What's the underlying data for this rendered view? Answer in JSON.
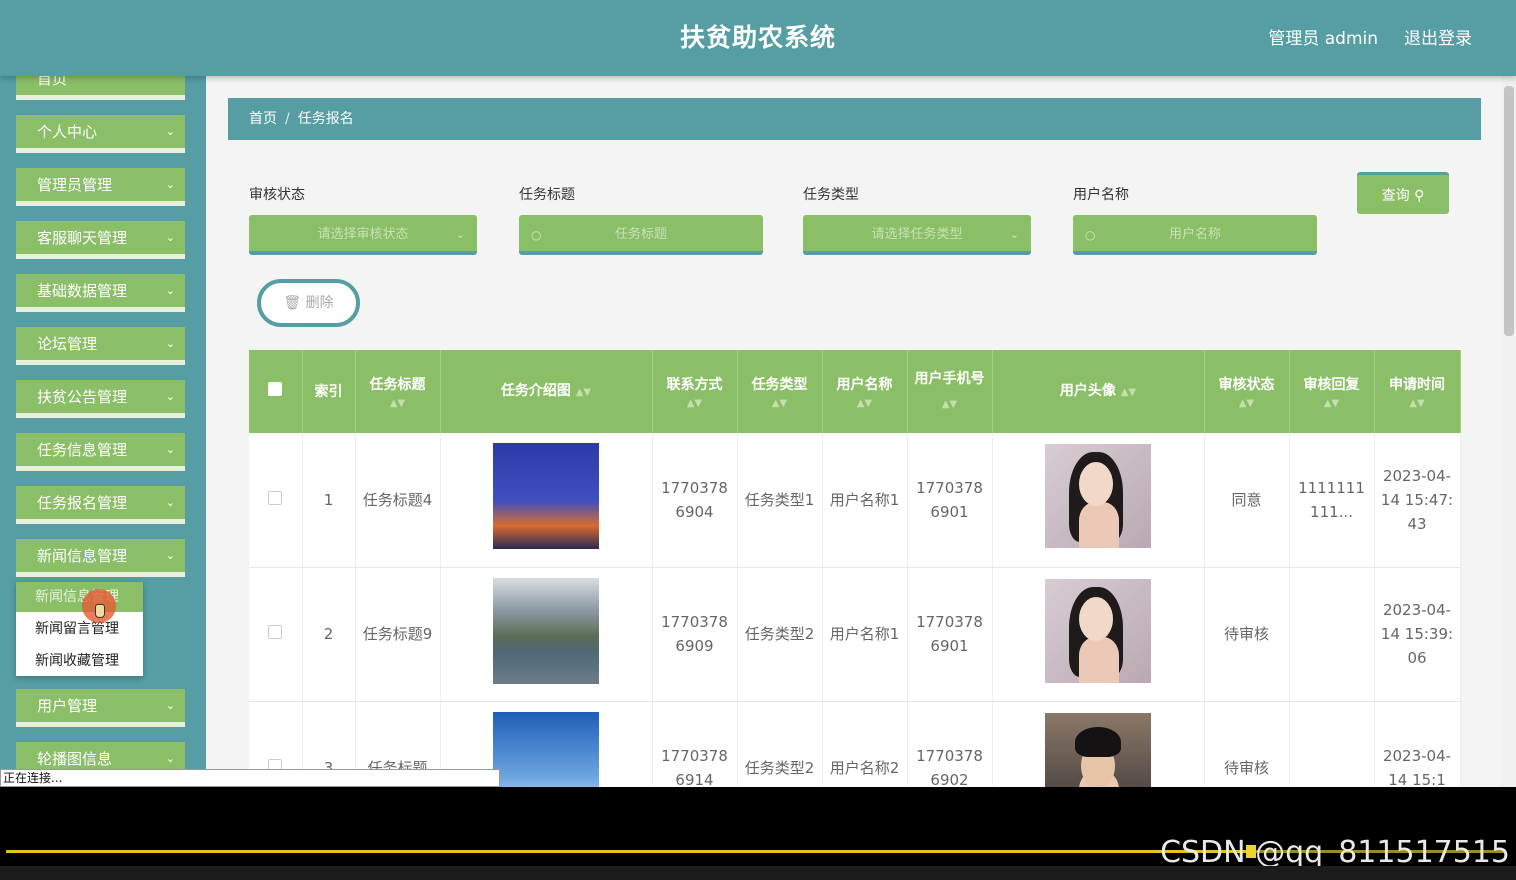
{
  "header": {
    "title": "扶贫助农系统",
    "user": "管理员 admin",
    "logout": "退出登录"
  },
  "sidebar": {
    "items": [
      {
        "label": "首页"
      },
      {
        "label": "个人中心"
      },
      {
        "label": "管理员管理"
      },
      {
        "label": "客服聊天管理"
      },
      {
        "label": "基础数据管理"
      },
      {
        "label": "论坛管理"
      },
      {
        "label": "扶贫公告管理"
      },
      {
        "label": "任务信息管理"
      },
      {
        "label": "任务报名管理"
      },
      {
        "label": "新闻信息管理"
      },
      {
        "label": "用户管理"
      },
      {
        "label": "轮播图信息"
      }
    ],
    "submenu": [
      {
        "label": "新闻信息管理"
      },
      {
        "label": "新闻留言管理"
      },
      {
        "label": "新闻收藏管理"
      }
    ]
  },
  "breadcrumb": {
    "home": "首页",
    "sep": "/",
    "current": "任务报名"
  },
  "filters": [
    {
      "label": "审核状态",
      "placeholder": "请选择审核状态"
    },
    {
      "label": "任务标题",
      "placeholder": "任务标题"
    },
    {
      "label": "任务类型",
      "placeholder": "请选择任务类型"
    },
    {
      "label": "用户名称",
      "placeholder": "用户名称"
    }
  ],
  "actions": {
    "query": "查询",
    "delete": "删除"
  },
  "table": {
    "columns": [
      "索引",
      "任务标题",
      "任务介绍图",
      "联系方式",
      "任务类型",
      "用户名称",
      "用户手机号",
      "用户头像",
      "审核状态",
      "审核回复",
      "申请时间"
    ],
    "rows": [
      {
        "index": "1",
        "title": "任务标题4",
        "image": "eiffel-tower",
        "contact": "17703786904",
        "type": "任务类型1",
        "user": "用户名称1",
        "phone": "17703786901",
        "avatar": "woman",
        "status": "同意",
        "reply": "1111111111...",
        "time": "2023-04-14 15:47:43"
      },
      {
        "index": "2",
        "title": "任务标题9",
        "image": "mountain-lake",
        "contact": "17703786909",
        "type": "任务类型2",
        "user": "用户名称1",
        "phone": "17703786901",
        "avatar": "woman",
        "status": "待审核",
        "reply": "",
        "time": "2023-04-14 15:39:06"
      },
      {
        "index": "3",
        "title": "任务标题",
        "image": "blue-sky",
        "contact": "17703786914",
        "type": "任务类型2",
        "user": "用户名称2",
        "phone": "17703786902",
        "avatar": "man",
        "status": "待审核",
        "reply": "",
        "time": "2023-04-14 15:1"
      }
    ]
  },
  "status_bar": "正在连接...",
  "player": {
    "progress": 0.83,
    "watermark": "CSDN @qq_811517515"
  }
}
